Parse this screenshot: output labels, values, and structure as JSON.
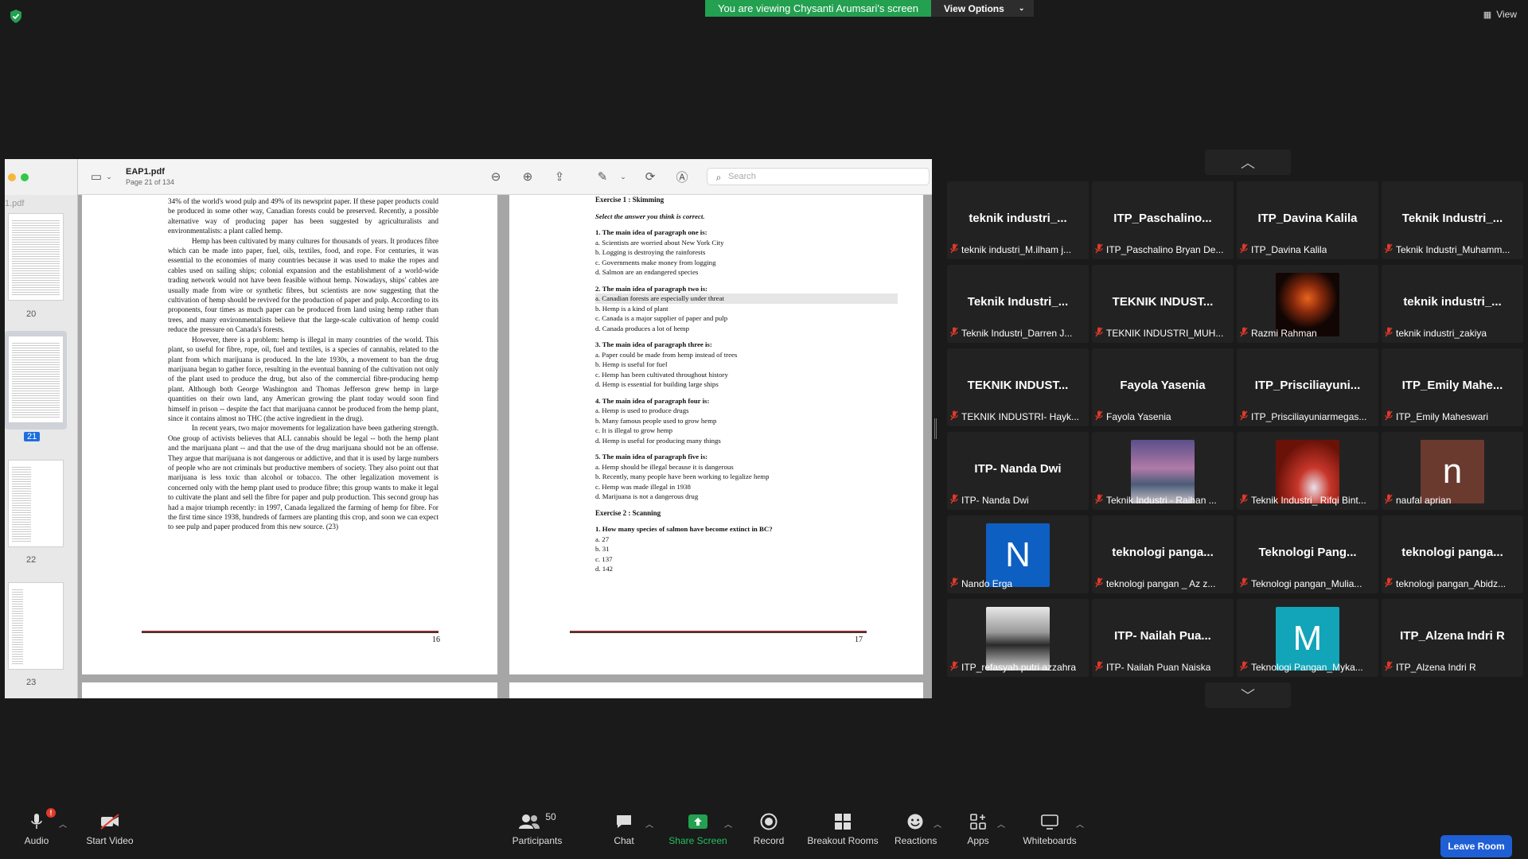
{
  "top": {
    "banner_text": "You are viewing Chysanti Arumsari's screen",
    "view_options": "View Options",
    "view_label": "View"
  },
  "pdf": {
    "file_name": "EAP1.pdf",
    "page_info": "Page 21 of 134",
    "search_placeholder": "Search",
    "side_file": "1.pdf",
    "thumb_pages": [
      "20",
      "21",
      "22",
      "23"
    ],
    "left_page": {
      "paragraphs": [
        "34% of the world's wood pulp and 49% of its newsprint paper. If these paper products could be produced in some other way, Canadian forests could be preserved. Recently, a possible alternative way of producing paper has been suggested by agriculturalists and environmentalists: a plant called hemp.",
        "Hemp has been cultivated by many cultures for thousands of years. It produces fibre which can be made into paper, fuel, oils, textiles, food, and rope. For centuries, it was essential to the economies of many countries because it was used to make the ropes and cables used on sailing ships; colonial expansion and the establishment of a world-wide trading network would not have been feasible without hemp. Nowadays, ships' cables are usually made from wire or synthetic fibres, but scientists are now suggesting that the cultivation of hemp should be revived for the production of paper and pulp. According to its proponents, four times as much paper can be produced from land using hemp rather than trees, and many environmentalists believe that the large-scale cultivation of hemp could reduce the pressure on Canada's forests.",
        "However, there is a problem: hemp is illegal in many countries of the world. This plant, so useful for fibre, rope, oil, fuel and textiles, is a species of cannabis, related to the plant from which marijuana is produced. In the late 1930s, a movement to ban the drug marijuana began to gather force, resulting in the eventual banning of the cultivation not only of the plant used to produce the drug, but also of the commercial fibre-producing hemp plant. Although both George Washington and Thomas Jefferson grew hemp in large quantities on their own land, any American growing the plant today would soon find himself in prison -- despite the fact that marijuana cannot be produced from the hemp plant, since it contains almost no THC (the active ingredient in the drug).",
        "In recent years, two major movements for legalization have been gathering strength. One group of activists believes that ALL cannabis should be legal -- both the hemp plant and the marijuana plant -- and that the use of the drug marijuana should not be an offense. They argue that marijuana is not dangerous or addictive, and that it is used by large numbers of people who are not criminals but productive members of society. They also point out that marijuana is less toxic than alcohol or tobacco. The other legalization movement is concerned only with the hemp plant used to produce fibre; this group wants to make it legal to cultivate the plant and sell the fibre for paper and pulp production. This second group has had a major triumph recently: in 1997, Canada legalized the farming of hemp for fibre. For the first time since 1938, hundreds of farmers are planting this crop, and soon we can expect to see pulp and paper produced from this new source. (23)"
      ],
      "page_number": "16"
    },
    "right_page": {
      "ex1_title": "Exercise 1 : Skimming",
      "instruction": "Select the answer you think is correct.",
      "questions": [
        {
          "q": "1.   The main idea of paragraph one is:",
          "opts": [
            "a.   Scientists are worried about New York City",
            "b.   Logging is destroying the rainforests",
            "c.   Governments make money from logging",
            "d.   Salmon are an endangered species"
          ]
        },
        {
          "q": "2.   The main idea of paragraph two is:",
          "opts": [
            "a.   Canadian forests are especially under threat",
            "b.   Hemp is a kind of plant",
            "c.   Canada is a major supplier of paper and pulp",
            "d.   Canada produces a lot of hemp"
          ]
        },
        {
          "q": "3.   The main idea of paragraph three is:",
          "opts": [
            "a.   Paper could be made from hemp instead of trees",
            "b.   Hemp is useful for fuel",
            "c.   Hemp has been cultivated throughout history",
            "d.   Hemp is essential for building large ships"
          ]
        },
        {
          "q": "4.   The main idea of paragraph four is:",
          "opts": [
            "a.   Hemp is used to produce drugs",
            "b.   Many famous people used to grow hemp",
            "c.   It is illegal to grow hemp",
            "d.   Hemp is useful for producing many things"
          ]
        },
        {
          "q": "5.   The main idea of paragraph five is:",
          "opts": [
            "a.   Hemp should be illegal because it is dangerous",
            "b.   Recently, many people have been working to legalize hemp",
            "c.   Hemp was made illegal in 1938",
            "d.   Marijuana is not a dangerous drug"
          ]
        }
      ],
      "ex2_title": "Exercise 2 : Scanning",
      "ex2_question": "1.   How many species of salmon have become extinct in BC?",
      "ex2_opts": [
        "a.   27",
        "b.   31",
        "c.   137",
        "d.   142"
      ],
      "page_number": "17"
    }
  },
  "gallery": {
    "tiles": [
      {
        "name": "teknik  industri_...",
        "label": "teknik industri_M.ilham j...",
        "avatar": ""
      },
      {
        "name": "ITP_Paschalino...",
        "label": "ITP_Paschalino Bryan De...",
        "avatar": ""
      },
      {
        "name": "ITP_Davina Kalila",
        "label": "ITP_Davina Kalila",
        "avatar": ""
      },
      {
        "name": "Teknik  Industri_...",
        "label": "Teknik Industri_Muhamm...",
        "avatar": ""
      },
      {
        "name": "Teknik  Industri_...",
        "label": "Teknik Industri_Darren J...",
        "avatar": ""
      },
      {
        "name": "TEKNIK  INDUST...",
        "label": "TEKNIK INDUSTRI_MUH...",
        "avatar": ""
      },
      {
        "name": "",
        "label": "Razmi Rahman",
        "avatar": "photo-fire"
      },
      {
        "name": "teknik  industri_...",
        "label": "teknik industri_zakiya",
        "avatar": ""
      },
      {
        "name": "TEKNIK  INDUST...",
        "label": "TEKNIK INDUSTRI- Hayk...",
        "avatar": ""
      },
      {
        "name": "Fayola Yasenia",
        "label": "Fayola Yasenia",
        "avatar": ""
      },
      {
        "name": "ITP_Prisciliayuni...",
        "label": "ITP_Prisciliayuniarmegas...",
        "avatar": ""
      },
      {
        "name": "ITP_Emily  Mahe...",
        "label": "ITP_Emily Maheswari",
        "avatar": ""
      },
      {
        "name": "ITP- Nanda Dwi",
        "label": "ITP- Nanda Dwi",
        "avatar": ""
      },
      {
        "name": "",
        "label": "Teknik Industri - Raihan ...",
        "avatar": "photo-sky"
      },
      {
        "name": "",
        "label": "Teknik Industri_ Rifqi Bint...",
        "avatar": "photo-comet"
      },
      {
        "name": "",
        "label": "naufal aprian",
        "avatar": "letter-n-brown"
      },
      {
        "name": "",
        "label": "Nando Erga",
        "avatar": "letter-N-blue"
      },
      {
        "name": "teknologi  panga...",
        "label": "teknologi pangan _ Az z...",
        "avatar": ""
      },
      {
        "name": "Teknologi  Pang...",
        "label": "Teknologi pangan_Mulia...",
        "avatar": ""
      },
      {
        "name": "teknologi  panga...",
        "label": "teknologi pangan_Abidz...",
        "avatar": ""
      },
      {
        "name": "",
        "label": "ITP_refasyah putri azzahra",
        "avatar": "photo-bw"
      },
      {
        "name": "ITP- Nailah  Pua...",
        "label": "ITP- Nailah Puan Naiska",
        "avatar": ""
      },
      {
        "name": "",
        "label": "Teknologi Pangan_Myka...",
        "avatar": "letter-M-teal"
      },
      {
        "name": "ITP_Alzena Indri R",
        "label": "ITP_Alzena Indri R",
        "avatar": ""
      }
    ],
    "avatar_letters": {
      "letter-n-brown": "n",
      "letter-N-blue": "N",
      "letter-M-teal": "M"
    },
    "colors": {
      "brown": "#6b3a2e",
      "blue": "#0e5fc2",
      "teal": "#12a4b8",
      "mute": "#e0392b"
    }
  },
  "toolbar": {
    "audio": "Audio",
    "audio_badge": "!",
    "video": "Start Video",
    "participants": "Participants",
    "participants_count": "50",
    "chat": "Chat",
    "share": "Share Screen",
    "record": "Record",
    "breakout": "Breakout Rooms",
    "reactions": "Reactions",
    "apps": "Apps",
    "whiteboards": "Whiteboards",
    "leave": "Leave Room"
  },
  "accent_colors": {
    "share_green": "#23a050",
    "leave_blue": "#1f5fd6"
  }
}
